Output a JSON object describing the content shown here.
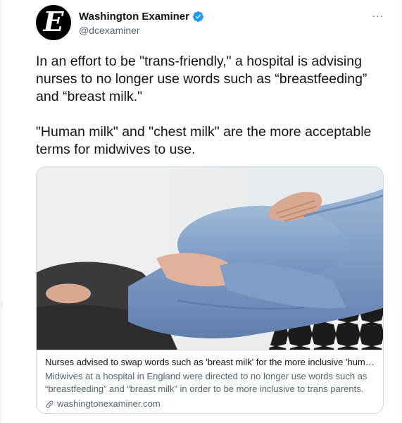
{
  "author": {
    "display_name": "Washington Examiner",
    "handle": "@dcexaminer",
    "avatar_letter": "E",
    "verified": true
  },
  "more_menu_glyph": "···",
  "tweet": {
    "paragraphs": [
      "In an effort to be \"trans-friendly,\" a hospital is advising nurses to no longer use words such as “breastfeeding” and “breast milk.\"",
      "\"Human milk\" and \"chest milk\" are the more acceptable terms for midwives to use."
    ]
  },
  "card": {
    "title": "Nurses advised to swap words such as 'breast milk' for the more inclusive 'human...",
    "description": "Midwives at a hospital in England were directed to no longer use words such as “breastfeeding” and “breast milk” in order to be more inclusive to trans parents.",
    "domain": "washingtonexaminer.com"
  },
  "colors": {
    "verified_blue": "#1d9bf0",
    "secondary_text": "#536471",
    "border": "#cfd9de"
  }
}
